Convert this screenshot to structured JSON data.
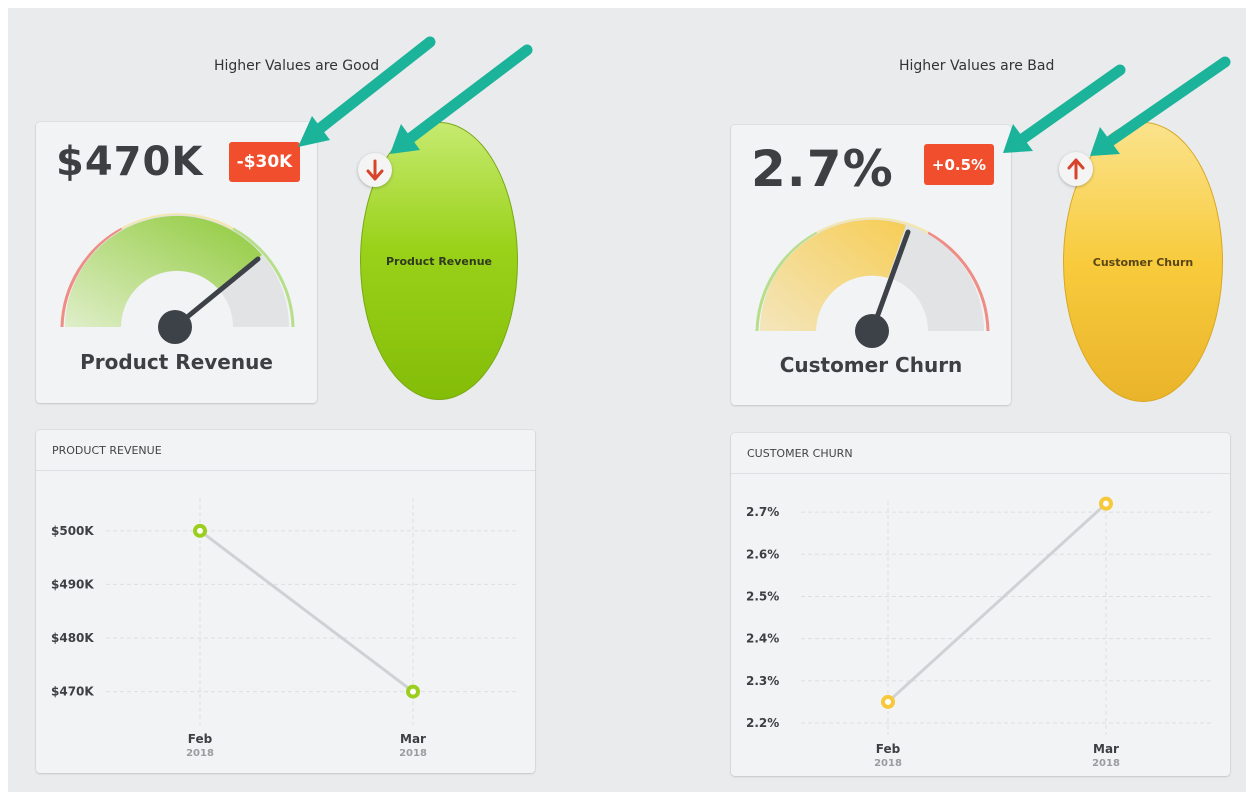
{
  "annotations": {
    "left": "Higher Values are Good",
    "right": "Higher Values are Bad"
  },
  "colors": {
    "arrow": "#1bb39a",
    "badge": "#f04e2c",
    "green": "#9ccf1d",
    "yellow": "#f7c93a",
    "needle": "#3d4148",
    "trend_arrow": "#d6452a"
  },
  "kpis": [
    {
      "value": "$470K",
      "delta": "-$30K",
      "label": "Product Revenue",
      "trend": "down",
      "trend_icon": "arrow-down-icon",
      "gauge_level": 0.8,
      "bubble_label": "Product Revenue"
    },
    {
      "value": "2.7%",
      "delta": "+0.5%",
      "label": "Customer Churn",
      "trend": "up",
      "trend_icon": "arrow-up-icon",
      "gauge_level": 0.6,
      "bubble_label": "Customer Churn"
    }
  ],
  "panels": [
    {
      "title": "PRODUCT REVENUE"
    },
    {
      "title": "CUSTOMER CHURN"
    }
  ],
  "chart_data": [
    {
      "type": "line",
      "title": "PRODUCT REVENUE",
      "x": [
        {
          "label": "Feb",
          "sub": "2018"
        },
        {
          "label": "Mar",
          "sub": "2018"
        }
      ],
      "y_ticks": [
        {
          "value": 500,
          "label": "$500K"
        },
        {
          "value": 490,
          "label": "$490K"
        },
        {
          "value": 480,
          "label": "$480K"
        },
        {
          "value": 470,
          "label": "$470K"
        }
      ],
      "series": [
        {
          "values": [
            500,
            470
          ]
        }
      ],
      "ylim": [
        466,
        508
      ],
      "grid": true
    },
    {
      "type": "line",
      "title": "CUSTOMER CHURN",
      "x": [
        {
          "label": "Feb",
          "sub": "2018"
        },
        {
          "label": "Mar",
          "sub": "2018"
        }
      ],
      "y_ticks": [
        {
          "value": 2.7,
          "label": "2.7%"
        },
        {
          "value": 2.6,
          "label": "2.6%"
        },
        {
          "value": 2.5,
          "label": "2.5%"
        },
        {
          "value": 2.4,
          "label": "2.4%"
        },
        {
          "value": 2.3,
          "label": "2.3%"
        },
        {
          "value": 2.2,
          "label": "2.2%"
        }
      ],
      "series": [
        {
          "values": [
            2.25,
            2.72
          ]
        }
      ],
      "ylim": [
        2.2,
        2.75
      ],
      "grid": true
    }
  ]
}
